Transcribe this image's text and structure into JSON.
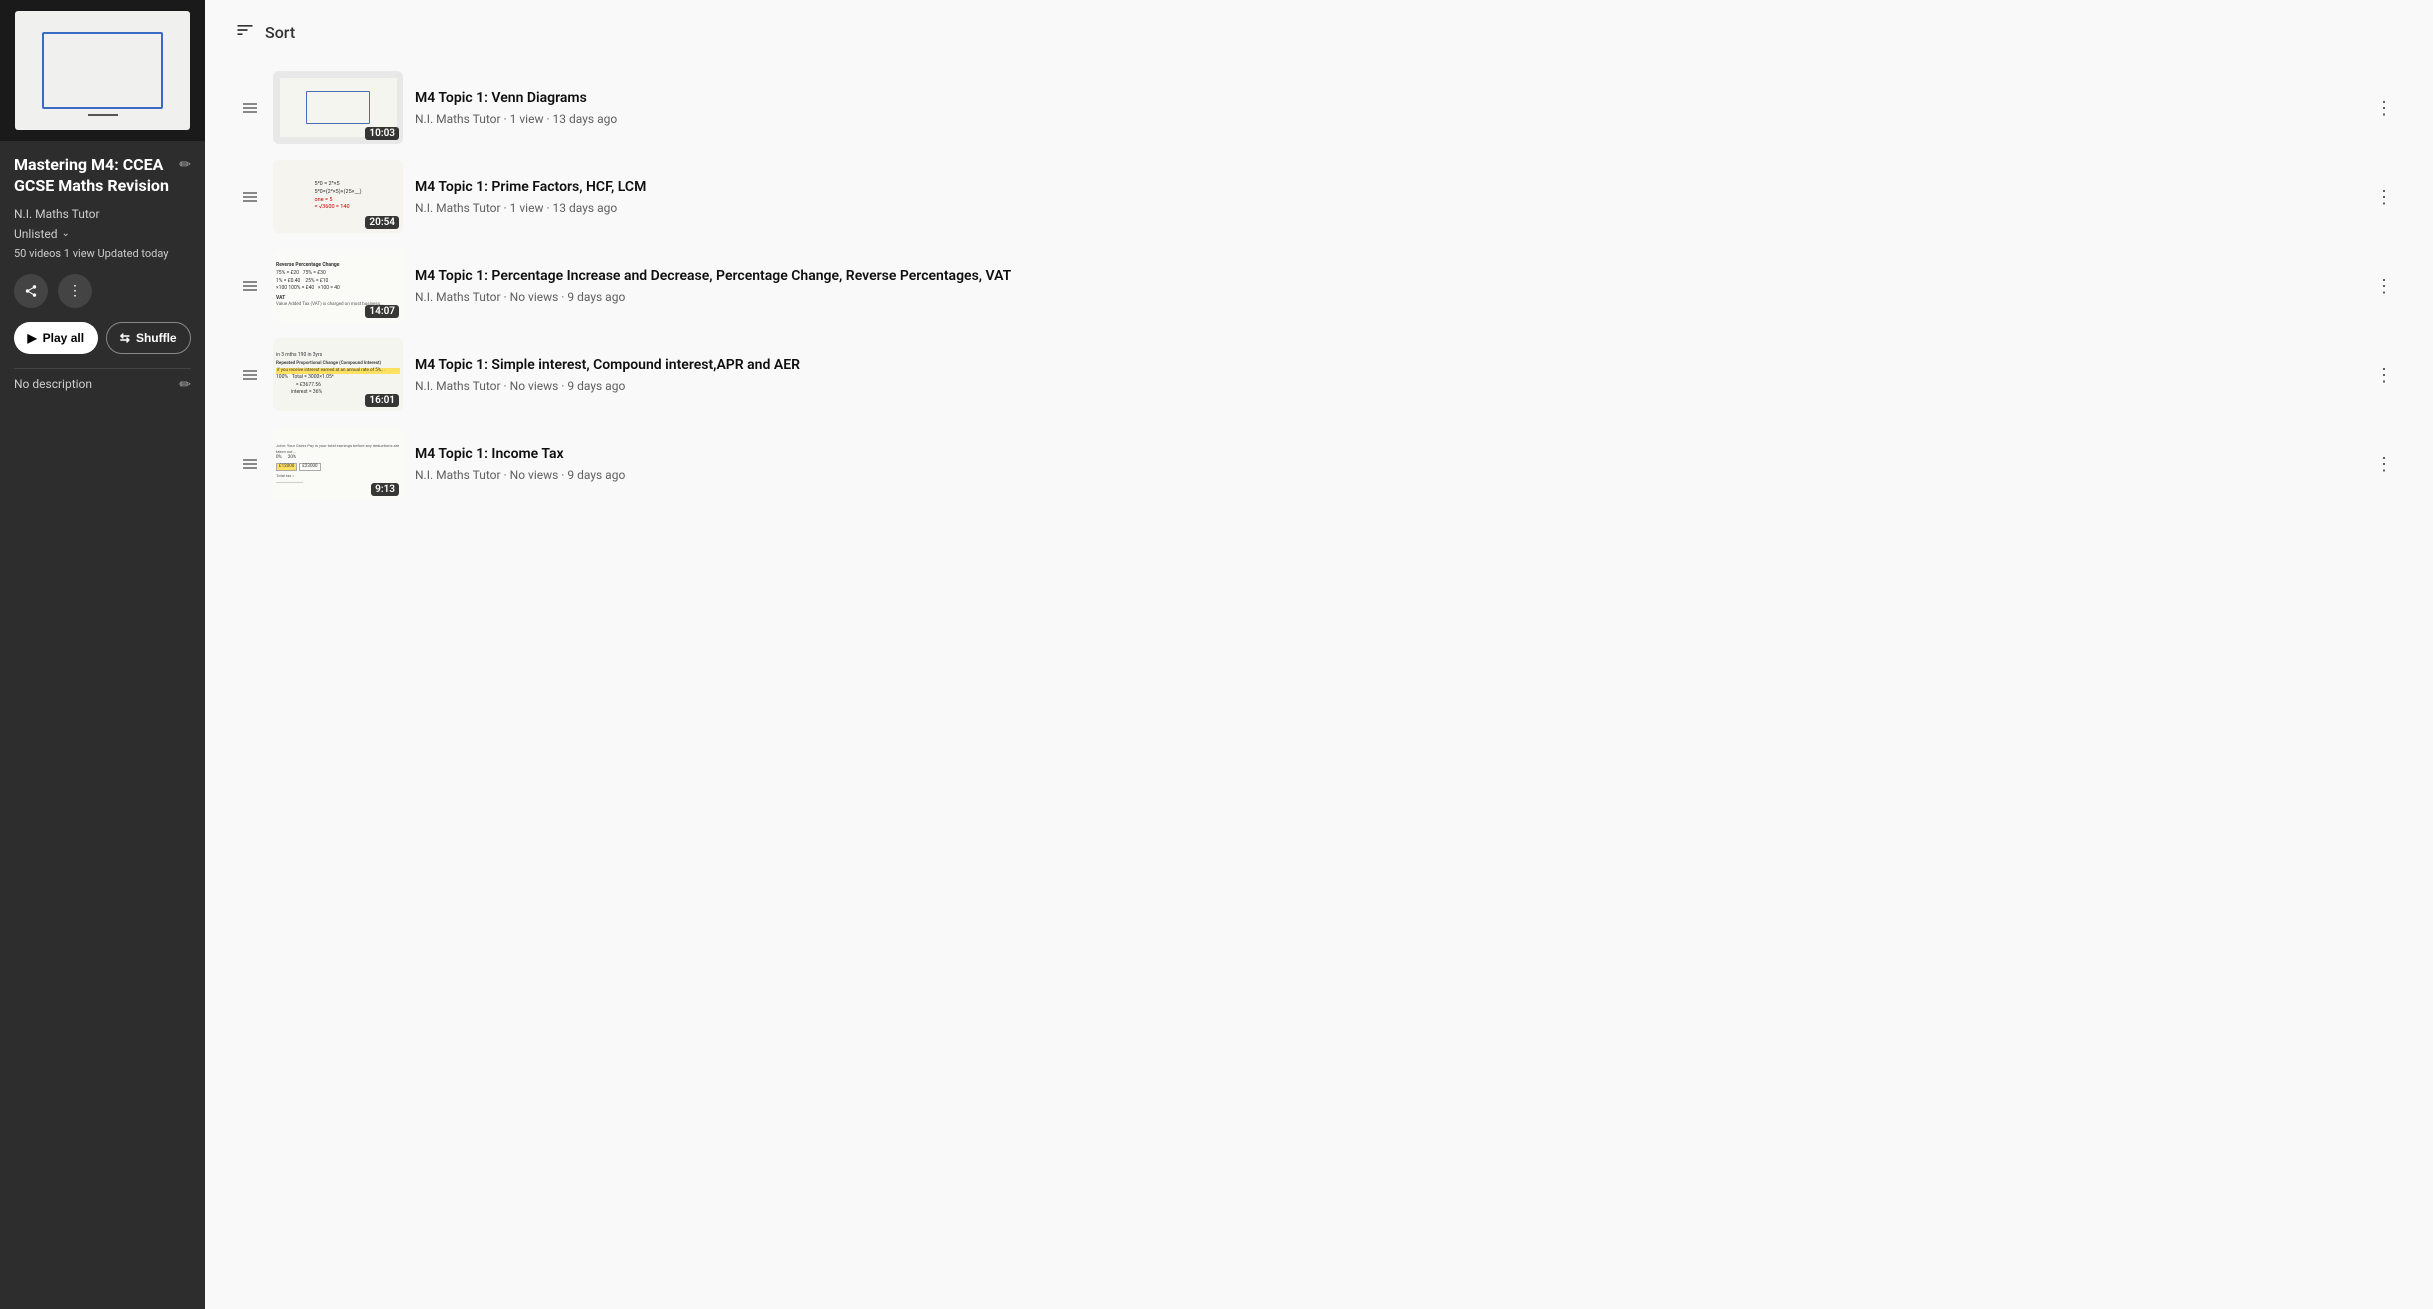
{
  "leftPanel": {
    "title": "Mastering M4: CCEA GCSE Maths Revision",
    "channelName": "N.I. Maths Tutor",
    "visibility": "Unlisted",
    "stats": "50 videos  1 view  Updated today",
    "description": "No description",
    "playAllLabel": "Play all",
    "shuffleLabel": "Shuffle"
  },
  "sortBar": {
    "label": "Sort"
  },
  "videos": [
    {
      "title": "M4 Topic 1: Venn Diagrams",
      "meta": "N.I. Maths Tutor · 1 view · 13 days ago",
      "duration": "10:03",
      "thumbType": "rect"
    },
    {
      "title": "M4 Topic 1: Prime Factors, HCF, LCM",
      "meta": "N.I. Maths Tutor · 1 view · 13 days ago",
      "duration": "20:54",
      "thumbType": "math"
    },
    {
      "title": "M4 Topic 1: Percentage Increase and Decrease, Percentage Change, Reverse Percentages, VAT",
      "meta": "N.I. Maths Tutor · No views · 9 days ago",
      "duration": "14:07",
      "thumbType": "percent"
    },
    {
      "title": "M4 Topic 1: Simple interest, Compound interest,APR and AER",
      "meta": "N.I. Maths Tutor · No views · 9 days ago",
      "duration": "16:01",
      "thumbType": "compound"
    },
    {
      "title": "M4 Topic 1: Income Tax",
      "meta": "N.I. Maths Tutor · No views · 9 days ago",
      "duration": "9:13",
      "thumbType": "tax"
    }
  ]
}
